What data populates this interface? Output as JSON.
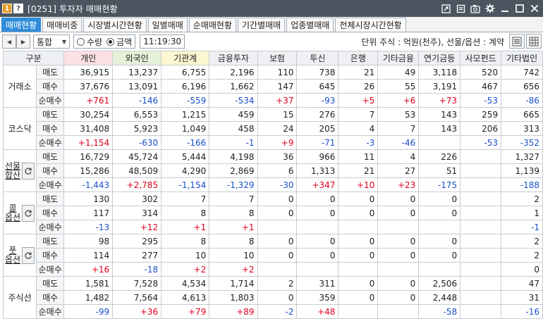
{
  "window": {
    "badge_num": "1",
    "badge_help": "?",
    "title": "[0251] 투자자 매매현황"
  },
  "tabs": [
    {
      "label": "매매현황",
      "active": true
    },
    {
      "label": "매매비중"
    },
    {
      "label": "시장별시간현황"
    },
    {
      "label": "일별매매"
    },
    {
      "label": "순매매현황"
    },
    {
      "label": "기간별매매"
    },
    {
      "label": "업종별매매"
    },
    {
      "label": "전체시장시간현황"
    }
  ],
  "toolbar": {
    "combo_value": "통합",
    "radio_qty": "수량",
    "radio_amount": "금액",
    "selected": "amount",
    "time": "11:19:30",
    "unit_text": "단위 주식 : 억원(천주), 선물/옵션 : 계약"
  },
  "grid": {
    "header_category": "구분",
    "columns": [
      "개인",
      "외국인",
      "기관계",
      "금융투자",
      "보험",
      "투신",
      "은행",
      "기타금융",
      "연기금등",
      "사모펀드",
      "기타법인"
    ],
    "row_types": [
      "매도",
      "매수",
      "순매수"
    ],
    "markets": [
      {
        "name": "거래소",
        "rows": [
          [
            "36,915",
            "13,237",
            "6,755",
            "2,196",
            "110",
            "738",
            "21",
            "49",
            "3,118",
            "520",
            "742"
          ],
          [
            "37,676",
            "13,091",
            "6,196",
            "1,662",
            "147",
            "645",
            "26",
            "55",
            "3,191",
            "467",
            "656"
          ],
          [
            "+761",
            "-146",
            "-559",
            "-534",
            "+37",
            "-93",
            "+5",
            "+6",
            "+73",
            "-53",
            "-86"
          ]
        ]
      },
      {
        "name": "코스닥",
        "rows": [
          [
            "30,254",
            "6,553",
            "1,215",
            "459",
            "15",
            "276",
            "7",
            "53",
            "143",
            "259",
            "665"
          ],
          [
            "31,408",
            "5,923",
            "1,049",
            "458",
            "24",
            "205",
            "4",
            "7",
            "143",
            "206",
            "313"
          ],
          [
            "+1,154",
            "-630",
            "-166",
            "-1",
            "+9",
            "-71",
            "-3",
            "-46",
            "",
            "-53",
            "-352"
          ]
        ]
      },
      {
        "name": "선물합산",
        "line1": "선물",
        "line2": "합산",
        "refresh": true,
        "rows": [
          [
            "16,729",
            "45,724",
            "5,444",
            "4,198",
            "36",
            "966",
            "11",
            "4",
            "226",
            "",
            "1,327"
          ],
          [
            "15,286",
            "48,509",
            "4,290",
            "2,869",
            "6",
            "1,313",
            "21",
            "27",
            "51",
            "",
            "1,139"
          ],
          [
            "-1,443",
            "+2,785",
            "-1,154",
            "-1,329",
            "-30",
            "+347",
            "+10",
            "+23",
            "-175",
            "",
            "-188"
          ]
        ]
      },
      {
        "name": "콜옵션",
        "line1": "콜",
        "line2": "옵션",
        "refresh": true,
        "rows": [
          [
            "130",
            "302",
            "7",
            "7",
            "0",
            "0",
            "0",
            "0",
            "0",
            "",
            "2"
          ],
          [
            "117",
            "314",
            "8",
            "8",
            "0",
            "0",
            "0",
            "0",
            "0",
            "",
            "1"
          ],
          [
            "-13",
            "+12",
            "+1",
            "+1",
            "",
            "",
            "",
            "",
            "",
            "",
            "-1"
          ]
        ]
      },
      {
        "name": "풋옵션",
        "line1": "풋",
        "line2": "옵션",
        "refresh": true,
        "rows": [
          [
            "98",
            "295",
            "8",
            "8",
            "0",
            "0",
            "0",
            "0",
            "0",
            "",
            "2"
          ],
          [
            "114",
            "277",
            "10",
            "10",
            "0",
            "0",
            "0",
            "0",
            "0",
            "",
            "2"
          ],
          [
            "+16",
            "-18",
            "+2",
            "+2",
            "",
            "",
            "",
            "",
            "",
            "",
            "0"
          ]
        ]
      },
      {
        "name": "주식선",
        "rows": [
          [
            "1,581",
            "7,528",
            "4,534",
            "1,714",
            "2",
            "311",
            "0",
            "0",
            "2,506",
            "",
            "47"
          ],
          [
            "1,482",
            "7,564",
            "4,613",
            "1,803",
            "0",
            "359",
            "0",
            "0",
            "2,448",
            "",
            "31"
          ],
          [
            "-99",
            "+36",
            "+79",
            "+89",
            "-2",
            "+48",
            "",
            "",
            "-58",
            "",
            "-16"
          ]
        ]
      }
    ]
  },
  "colors": {
    "positive": "#e0001b",
    "negative": "#1a4fc7",
    "active_tab": "#2f8ddb",
    "title_bar": "#4a5560"
  }
}
